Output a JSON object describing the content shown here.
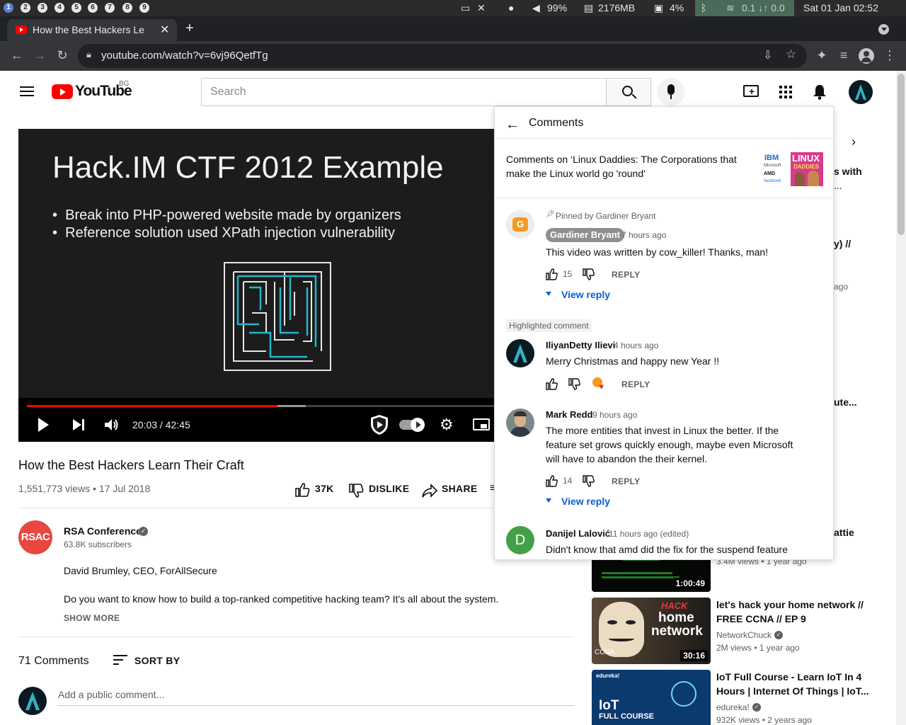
{
  "system": {
    "workspaces": [
      "1",
      "2",
      "3",
      "4",
      "5",
      "6",
      "7",
      "8",
      "9"
    ],
    "volume": "99%",
    "memory": "2176MB",
    "cpu": "4%",
    "network": "0.1 ↓↑ 0.0",
    "clock": "Sat 01 Jan 02:52"
  },
  "browser": {
    "tab_title": "How the Best Hackers Le",
    "url": "youtube.com/watch?v=6vj96QetfTg"
  },
  "yt_header": {
    "logo_text": "YouTube",
    "region": "BG",
    "search_placeholder": "Search"
  },
  "player": {
    "slide_title": "Hack.IM CTF 2012 Example",
    "slide_bullets": [
      "Break into PHP-powered website made by organizers",
      "Reference solution used XPath injection vulnerability"
    ],
    "time": "20:03 / 42:45",
    "progress": 0.53,
    "buffered": 0.59
  },
  "video": {
    "title": "How the Best Hackers Learn Their Craft",
    "stats": "1,551,773 views • 17 Jul 2018",
    "likes": "37K",
    "dislike_label": "DISLIKE",
    "share_label": "SHARE"
  },
  "channel": {
    "name": "RSA Conference",
    "subscribers": "63.8K subscribers",
    "avatar_text": "RSAC",
    "description_line1": "David Brumley, CEO, ForAllSecure",
    "description_line2": "Do you want to know how to build a top-ranked competitive hacking team? It's all about the system.",
    "show_more": "SHOW MORE"
  },
  "comments_section": {
    "count": "71 Comments",
    "sort_label": "SORT BY",
    "add_placeholder": "Add a public comment..."
  },
  "sidebar": {
    "partial_titles": [
      "s with",
      "...",
      "y) //",
      "ago",
      "ute...",
      "attie"
    ],
    "items": [
      {
        "title": "",
        "meta": "3.4M views • 1 year ago",
        "duration": "1:00:49"
      },
      {
        "title_line1": "let's hack your home network //",
        "title_line2": "FREE CCNA // EP 9",
        "channel": "NetworkChuck",
        "meta": "2M views • 1 year ago",
        "duration": "30:16",
        "thumb_text1": "HACK",
        "thumb_text2": "home",
        "thumb_text3": "network",
        "thumb_text4": "CCNA"
      },
      {
        "title_line1": "IoT Full Course - Learn IoT In 4",
        "title_line2": "Hours | Internet Of Things | IoT...",
        "channel": "edureka!",
        "meta": "932K views • 2 years ago",
        "thumb_text1": "edureka!",
        "thumb_text2": "IoT",
        "thumb_text3": "FULL COURSE"
      }
    ]
  },
  "panel": {
    "header": "Comments",
    "context": "Comments on ‘Linux Daddies: The Corporations that make the Linux world go 'round'",
    "thumb_text1": "LINUX",
    "thumb_text2": "DADDIES",
    "thumb_text3": "IBM",
    "thumb_text4": "Microsoft",
    "thumb_text5": "AMD",
    "thumb_text6": "facebook",
    "comments": [
      {
        "pinned": "Pinned by Gardiner Bryant",
        "author": "Gardiner Bryant",
        "time": "7 hours ago",
        "text": "This video was written by cow_killer! Thanks, man!",
        "likes": "15",
        "reply": "REPLY",
        "view_reply": "View reply"
      },
      {
        "badge": "Highlighted comment",
        "author": "IliyanDetty Ilievi",
        "time": "4 hours ago",
        "text": "Merry Christmas and happy new Year !!",
        "reply": "REPLY"
      },
      {
        "author": "Mark Redd",
        "time": "9 hours ago",
        "text_lines": [
          "The more entities that invest in Linux the better. If the",
          "feature set grows quickly enough, maybe even Microsoft",
          "will have to abandon the their kernel."
        ],
        "likes": "14",
        "reply": "REPLY",
        "view_reply": "View reply"
      },
      {
        "author": "Danijel Lalović",
        "time": "11 hours ago (edited)",
        "avatar_letter": "D",
        "text": "Didn't know that amd did the fix for the suspend feature"
      }
    ]
  }
}
